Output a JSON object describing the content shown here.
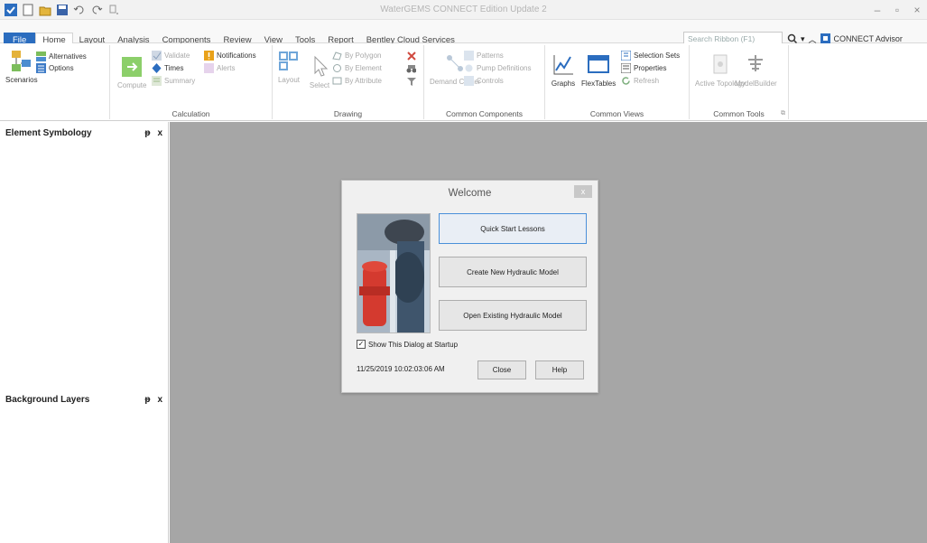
{
  "window": {
    "title": "WaterGEMS CONNECT Edition Update 2",
    "qat_icons": [
      "app-logo-icon",
      "new-file-icon",
      "open-file-icon",
      "save-icon",
      "undo-icon",
      "redo-icon",
      "customize-icon"
    ]
  },
  "tabs": [
    "Home",
    "Layout",
    "Analysis",
    "Components",
    "Review",
    "View",
    "Tools",
    "Report",
    "Bentley Cloud Services"
  ],
  "file_tab": "File",
  "search": {
    "placeholder": "Search Ribbon (F1)"
  },
  "connect_advisor": "CONNECT Advisor",
  "ribbon": {
    "scenarios": {
      "big": "Scenarios",
      "alternatives": "Alternatives",
      "options": "Options"
    },
    "calculation": {
      "label": "Calculation",
      "compute": "Compute",
      "validate": "Validate",
      "times": "Times",
      "summary": "Summary",
      "notifications": "Notifications",
      "alerts": "Alerts"
    },
    "drawing": {
      "label": "Drawing",
      "layout": "Layout",
      "select": "Select",
      "by_polygon": "By Polygon",
      "by_element": "By Element",
      "by_attribute": "By Attribute"
    },
    "common_components": {
      "label": "Common Components",
      "demand_center": "Demand Center",
      "patterns": "Patterns",
      "pump_definitions": "Pump Definitions",
      "controls": "Controls"
    },
    "common_views": {
      "label": "Common Views",
      "graphs": "Graphs",
      "flextables": "FlexTables",
      "selection_sets": "Selection Sets",
      "properties": "Properties",
      "refresh": "Refresh"
    },
    "common_tools": {
      "label": "Common Tools",
      "active_topology": "Active Topology",
      "modelbuilder": "ModelBuilder"
    }
  },
  "panels": {
    "element_symbology": "Element Symbology",
    "background_layers": "Background Layers",
    "pin": "ᵽ",
    "close": "x"
  },
  "dialog": {
    "title": "Welcome",
    "close": "x",
    "quick_start": "Quick Start Lessons",
    "create_new": "Create New Hydraulic Model",
    "open_existing": "Open Existing Hydraulic Model",
    "show_dialog": "Show This Dialog at Startup",
    "show_dialog_checked": true,
    "timestamp": "11/25/2019 10:02:03:06 AM",
    "close_btn": "Close",
    "help_btn": "Help"
  }
}
